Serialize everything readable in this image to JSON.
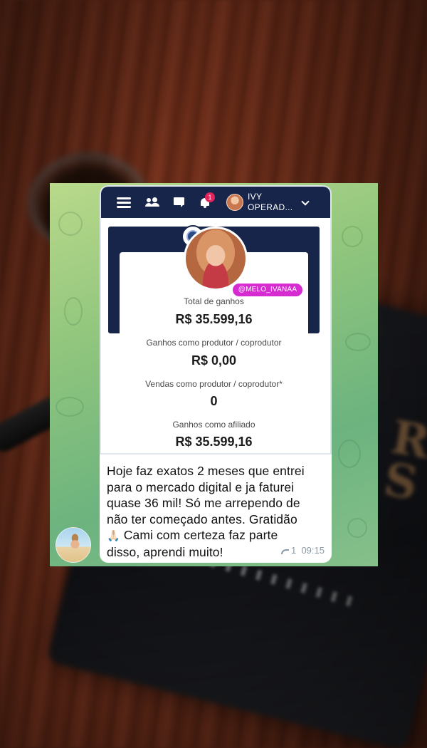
{
  "dashboard": {
    "username": "IVY OPERAD...",
    "notification_count": "1",
    "handle": "@MELO_IVANAA",
    "stats": [
      {
        "label": "Total de ganhos",
        "value": "R$ 35.599,16"
      },
      {
        "label": "Ganhos como produtor / coprodutor",
        "value": "R$ 0,00"
      },
      {
        "label": "Vendas como produtor / coprodutor*",
        "value": "0"
      },
      {
        "label": "Ganhos como afiliado",
        "value": "R$ 35.599,16"
      }
    ]
  },
  "message": {
    "line1": "Hoje faz exatos 2 meses que entrei",
    "line2": "para o mercado digital e ja faturei",
    "line3": "quase 36 mil! Só me arrependo de",
    "line4": "não ter começado antes. Gratidão",
    "emoji": "🙏🏻",
    "line5": " Cami com certeza faz parte",
    "line6": "disso, aprendi muito!",
    "reply_count": "1",
    "time": "09:15"
  },
  "icons": [
    "menu-icon",
    "users-icon",
    "chat-icon",
    "bell-icon",
    "chevron-down-icon",
    "reply-icon"
  ],
  "colors": {
    "navbar": "#17254a",
    "handle_tag": "#d62bd1",
    "chat_wallpaper": "#8fc57d"
  }
}
